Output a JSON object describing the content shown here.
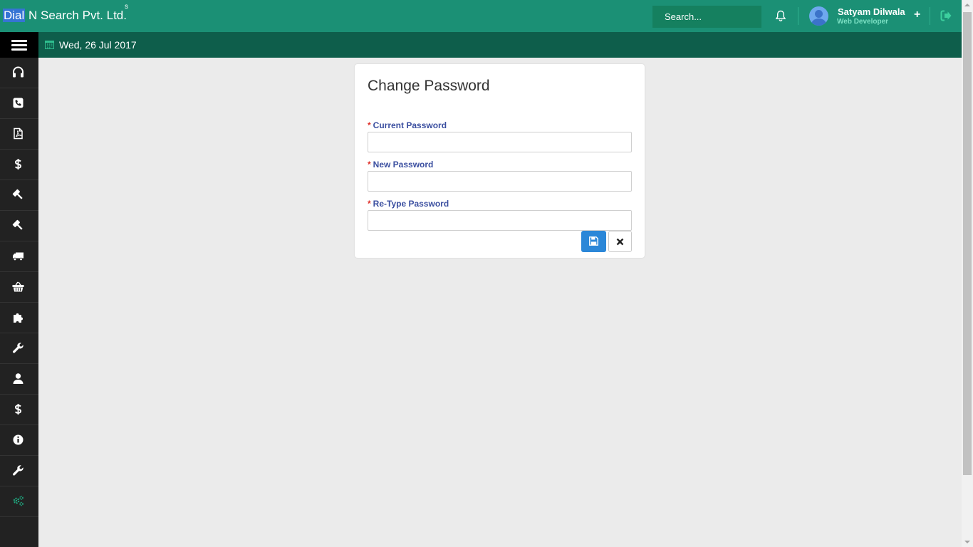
{
  "app": {
    "brand_highlight": "Dial",
    "brand_rest": " N Search Pvt. Ltd.",
    "brand_sup": "s"
  },
  "header": {
    "search_placeholder": "Search...",
    "user_name": "Satyam Dilwala",
    "user_role": "Web Developer",
    "plus_label": "+",
    "accent_color": "#1b9075"
  },
  "subbar": {
    "date": "Wed, 26 Jul 2017"
  },
  "sidebar": {
    "items": [
      {
        "icon": "headset-icon"
      },
      {
        "icon": "phone-icon"
      },
      {
        "icon": "pdf-file-icon"
      },
      {
        "icon": "dollar-icon"
      },
      {
        "icon": "gavel-icon"
      },
      {
        "icon": "gavel-icon"
      },
      {
        "icon": "truck-icon"
      },
      {
        "icon": "basket-icon"
      },
      {
        "icon": "puzzle-icon"
      },
      {
        "icon": "wrench-icon"
      },
      {
        "icon": "user-icon"
      },
      {
        "icon": "dollar-icon"
      },
      {
        "icon": "info-icon"
      },
      {
        "icon": "wrench-icon"
      },
      {
        "icon": "gears-icon"
      }
    ]
  },
  "form": {
    "title": "Change Password",
    "required_mark": "*",
    "fields": [
      {
        "label": "Current Password",
        "value": ""
      },
      {
        "label": "New Password",
        "value": ""
      },
      {
        "label": "Re-Type Password",
        "value": ""
      }
    ],
    "save_icon": "floppy-disk-icon",
    "cancel_icon": "close-icon"
  }
}
